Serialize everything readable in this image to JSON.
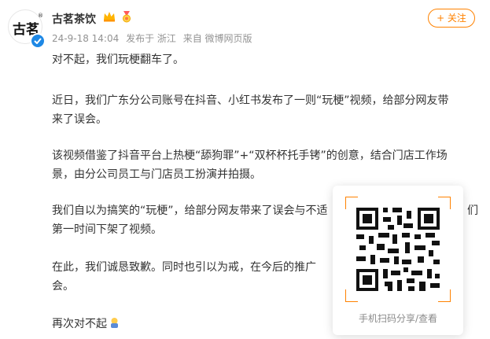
{
  "account": {
    "avatar_text": "古茗",
    "avatar_mark": "®",
    "name": "古茗茶饮"
  },
  "meta": {
    "date": "24-9-18 14:04",
    "location": "发布于 浙江",
    "source": "来自 微博网页版"
  },
  "follow_button": {
    "label": "+ 关注"
  },
  "post": {
    "paragraphs": [
      "对不起，我们玩梗翻车了。",
      "近日，我们广东分公司账号在抖音、小红书发布了一则“玩梗”视频，给部分网友带",
      "来了误会。",
      "该视频借鉴了抖音平台上热梗“舔狗罪”+“双杯杯托手铐”的创意，结合门店工作场",
      "景，由分公司员工与门店员工扮演并拍摄。",
      "我们自以为搞笑的“玩梗”，给部分网友带来了误会与不适",
      "们",
      "第一时间下架了视频。",
      "在此，我们诚恳致歉。同时也引以为戒，在今后的推广",
      "会。",
      "再次对不起"
    ]
  },
  "qr_popup": {
    "caption": "手机扫码分享/查看"
  },
  "colors": {
    "accent": "#ff8200",
    "meta_gray": "#939393",
    "verified_blue": "#1e88e5",
    "text": "#333333"
  }
}
